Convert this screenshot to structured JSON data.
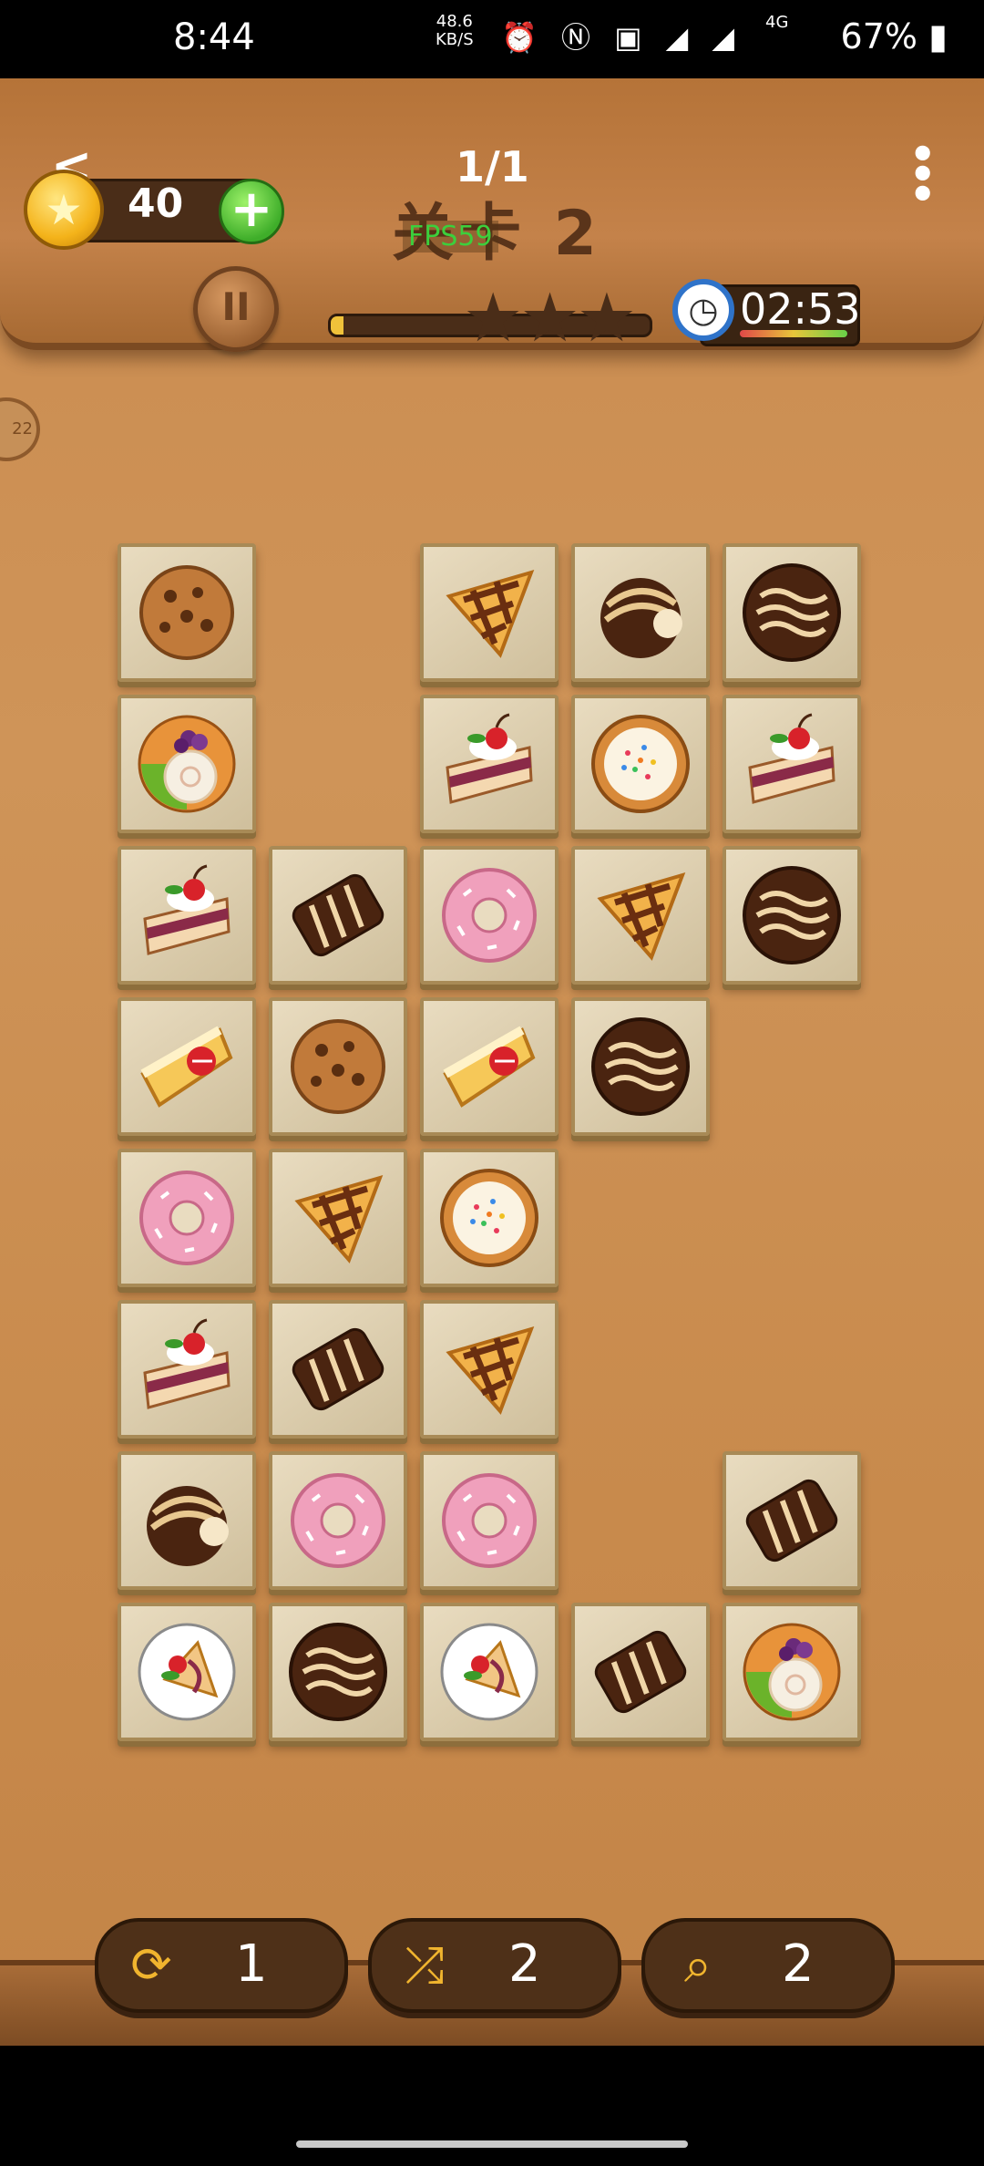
{
  "status_bar": {
    "time": "8:44",
    "net_speed": "48.6",
    "net_unit": "KB/S",
    "battery": "67%",
    "signal": "4G"
  },
  "header": {
    "coins": "40",
    "progress": "1/1",
    "level_title": "关卡 2",
    "fps": "FPS59",
    "timer": "02:53",
    "star_progress_fraction": 0.04
  },
  "side_badge": "22",
  "board": {
    "tiles": [
      {
        "row": 0,
        "col": 0,
        "item": "cookie"
      },
      {
        "row": 0,
        "col": 2,
        "item": "lattice-pie"
      },
      {
        "row": 0,
        "col": 3,
        "item": "chocolate-truffle"
      },
      {
        "row": 0,
        "col": 4,
        "item": "chocolate-cookie"
      },
      {
        "row": 1,
        "col": 0,
        "item": "fruit-tart"
      },
      {
        "row": 1,
        "col": 2,
        "item": "cherry-cake"
      },
      {
        "row": 1,
        "col": 3,
        "item": "sprinkle-pie"
      },
      {
        "row": 1,
        "col": 4,
        "item": "cherry-cake"
      },
      {
        "row": 2,
        "col": 0,
        "item": "cherry-cake"
      },
      {
        "row": 2,
        "col": 1,
        "item": "chocolate-bar"
      },
      {
        "row": 2,
        "col": 2,
        "item": "pink-donut"
      },
      {
        "row": 2,
        "col": 3,
        "item": "lattice-pie"
      },
      {
        "row": 2,
        "col": 4,
        "item": "chocolate-cookie"
      },
      {
        "row": 3,
        "col": 0,
        "item": "cheesecake"
      },
      {
        "row": 3,
        "col": 1,
        "item": "cookie"
      },
      {
        "row": 3,
        "col": 2,
        "item": "cheesecake"
      },
      {
        "row": 3,
        "col": 3,
        "item": "chocolate-cookie"
      },
      {
        "row": 4,
        "col": 0,
        "item": "pink-donut"
      },
      {
        "row": 4,
        "col": 1,
        "item": "lattice-pie"
      },
      {
        "row": 4,
        "col": 2,
        "item": "sprinkle-pie"
      },
      {
        "row": 5,
        "col": 0,
        "item": "cherry-cake"
      },
      {
        "row": 5,
        "col": 1,
        "item": "chocolate-bar"
      },
      {
        "row": 5,
        "col": 2,
        "item": "lattice-pie"
      },
      {
        "row": 6,
        "col": 0,
        "item": "chocolate-truffle"
      },
      {
        "row": 6,
        "col": 1,
        "item": "pink-donut"
      },
      {
        "row": 6,
        "col": 2,
        "item": "pink-donut"
      },
      {
        "row": 6,
        "col": 4,
        "item": "chocolate-bar"
      },
      {
        "row": 7,
        "col": 0,
        "item": "crepe-plate"
      },
      {
        "row": 7,
        "col": 1,
        "item": "chocolate-cookie"
      },
      {
        "row": 7,
        "col": 2,
        "item": "crepe-plate"
      },
      {
        "row": 7,
        "col": 3,
        "item": "chocolate-bar"
      },
      {
        "row": 7,
        "col": 4,
        "item": "fruit-tart"
      }
    ]
  },
  "tools": [
    {
      "name": "refresh-tool",
      "icon": "image-rotate-icon",
      "count": "1"
    },
    {
      "name": "shuffle-tool",
      "icon": "shuffle-icon",
      "count": "2"
    },
    {
      "name": "hint-tool",
      "icon": "search-icon",
      "count": "2"
    }
  ],
  "colors": {
    "wood": "#cf9458",
    "tile": "#e9dcc0",
    "accent_gold": "#f0b42e",
    "timer_blue": "#2f73c9"
  }
}
